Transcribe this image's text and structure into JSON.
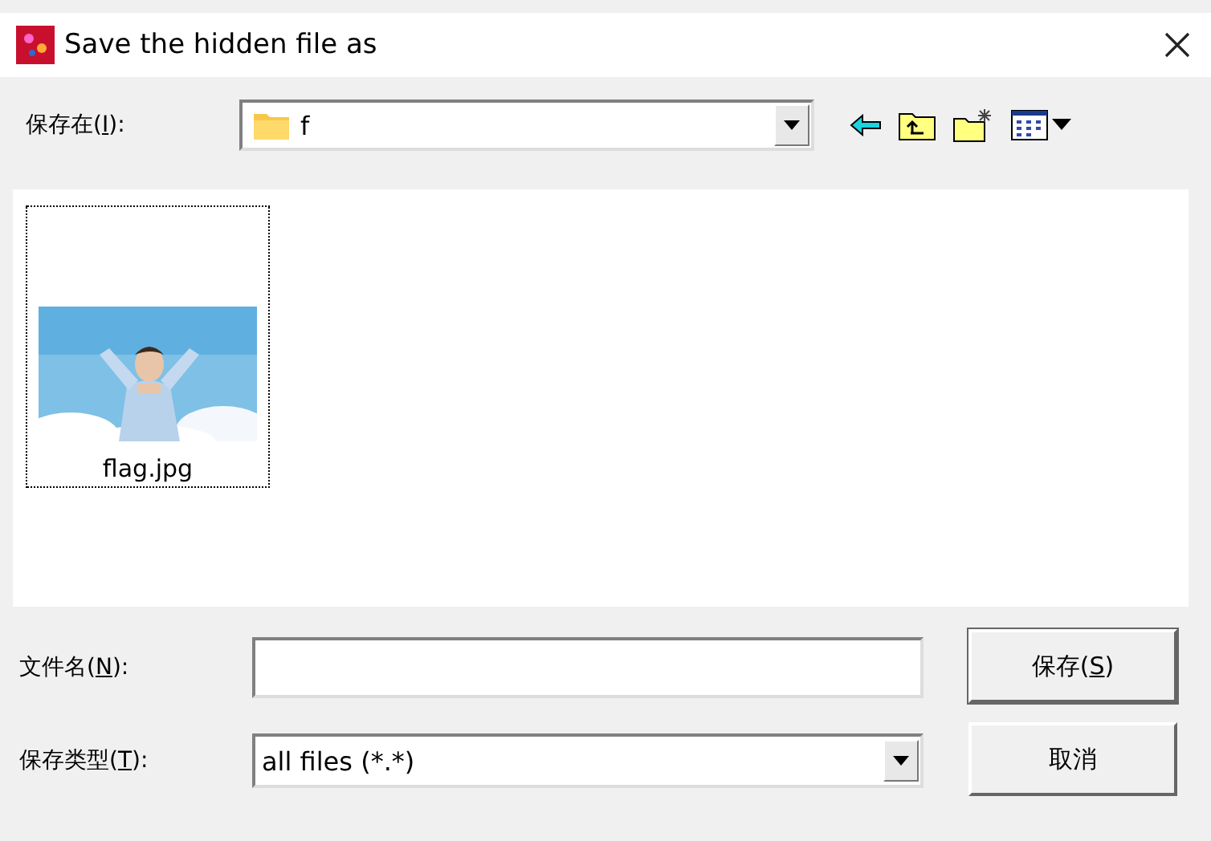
{
  "window": {
    "title": "Save the hidden file as"
  },
  "save_in": {
    "label": {
      "before": "保存在(",
      "key": "I",
      "after": "):"
    },
    "value": "f"
  },
  "files": [
    {
      "name": "flag.jpg",
      "kind": "picture",
      "selected": true
    }
  ],
  "file_name": {
    "label": {
      "before": "文件名(",
      "key": "N",
      "after": "):"
    }
  },
  "save_type": {
    "label": {
      "before": "保存类型(",
      "key": "T",
      "after": "):"
    },
    "value": "all files (*.*)"
  },
  "buttons": [
    {
      "label": {
        "before": "保存(",
        "key": "S",
        "after": ")"
      },
      "kind": "default"
    },
    {
      "label": {
        "before": "取消"
      },
      "kind": "normal"
    }
  ]
}
